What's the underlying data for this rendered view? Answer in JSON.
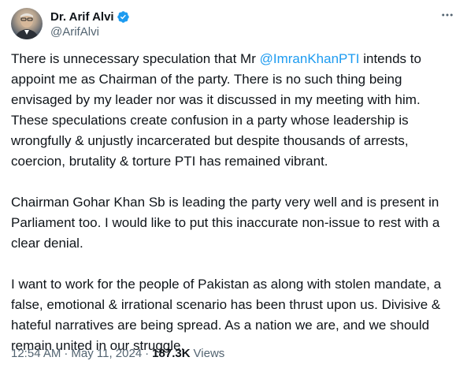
{
  "author": {
    "display_name": "Dr. Arif Alvi",
    "handle": "@ArifAlvi",
    "verified": true,
    "verified_color": "#1d9bf0"
  },
  "tweet": {
    "para1": {
      "before_mention": "There is unnecessary speculation that Mr ",
      "mention": "@ImranKhanPTI",
      "after_mention": " intends to appoint me as Chairman of the party.  There is no such thing being envisaged by my leader nor was it discussed in my meeting with him. These speculations create confusion in a party whose leadership is wrongfully & unjustly incarcerated but despite thousands of arrests, coercion, brutality & torture PTI has remained vibrant."
    },
    "para2": "Chairman Gohar Khan Sb is leading the party very well and is present in Parliament too. I would like to put this inaccurate non-issue to rest with a clear denial.",
    "para3": "I want to work for the people of Pakistan as along with stolen mandate, a false, emotional & irrational scenario has been thrust upon us. Divisive & hateful narratives are being spread. As a nation we are, and we should remain united in our struggle."
  },
  "meta": {
    "time": "12:54 AM",
    "separator": "·",
    "date": "May 11, 2024",
    "views_count": "187.3K",
    "views_label": "Views"
  },
  "colors": {
    "link": "#1d9bf0",
    "secondary_text": "#536471",
    "primary_text": "#0f1419"
  },
  "icons": {
    "more": "more-horizontal-icon",
    "verified": "verified-badge-icon"
  }
}
